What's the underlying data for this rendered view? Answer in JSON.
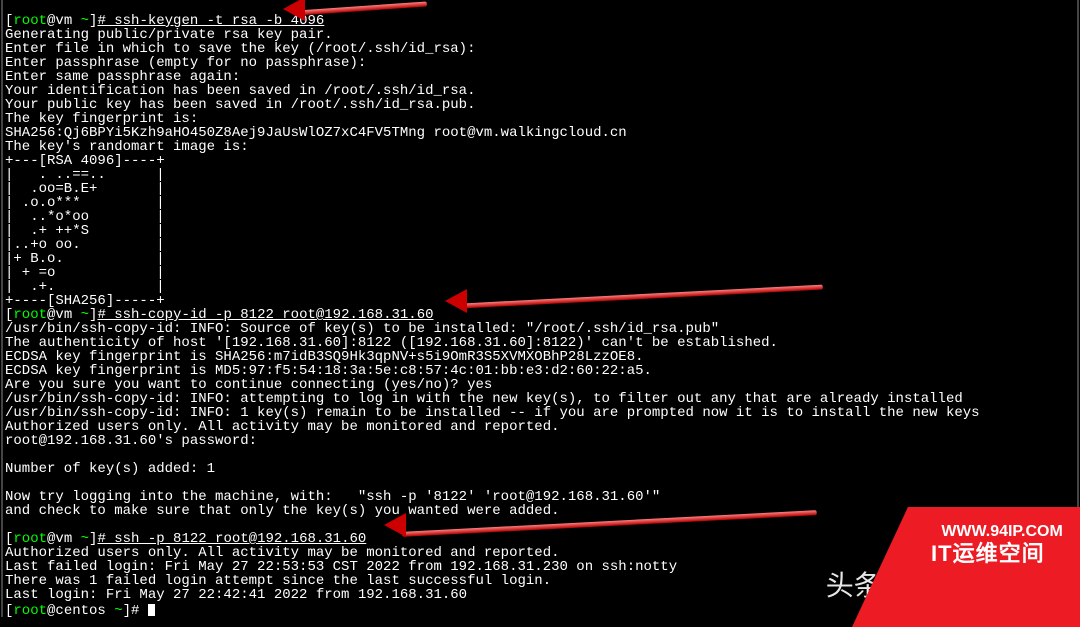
{
  "prompt1_user": "root",
  "prompt1_host": "@vm ",
  "prompt1_dir": "~",
  "prompt1_cmd": "# ssh-keygen -t rsa -b 4096",
  "l2": "Generating public/private rsa key pair.",
  "l3": "Enter file in which to save the key (/root/.ssh/id_rsa):",
  "l4": "Enter passphrase (empty for no passphrase):",
  "l5": "Enter same passphrase again:",
  "l6": "Your identification has been saved in /root/.ssh/id_rsa.",
  "l7": "Your public key has been saved in /root/.ssh/id_rsa.pub.",
  "l8": "The key fingerprint is:",
  "l9": "SHA256:Qj6BPYi5Kzh9aHO450Z8Aej9JaUsWlOZ7xC4FV5TMng root@vm.walkingcloud.cn",
  "l10": "The key's randomart image is:",
  "l11": "+---[RSA 4096]----+",
  "l12": "|   . ..==..      |",
  "l13": "|  .oo=B.E+       |",
  "l14": "| .o.o***         |",
  "l15": "|  ..*o*oo        |",
  "l16": "|  .+ ++*S        |",
  "l17": "|..+o oo.         |",
  "l18": "|+ B.o.           |",
  "l19": "| + =o            |",
  "l20": "|  .+.            |",
  "l21": "+----[SHA256]-----+",
  "prompt2_cmd": "# ssh-copy-id -p 8122 root@192.168.31.60",
  "l23": "/usr/bin/ssh-copy-id: INFO: Source of key(s) to be installed: \"/root/.ssh/id_rsa.pub\"",
  "l24": "The authenticity of host '[192.168.31.60]:8122 ([192.168.31.60]:8122)' can't be established.",
  "l25": "ECDSA key fingerprint is SHA256:m7idB3SQ9Hk3qpNV+s5i9OmR3S5XVMXOBhP28LzzOE8.",
  "l26": "ECDSA key fingerprint is MD5:97:f5:54:18:3a:5e:c8:57:4c:01:bb:e3:d2:60:22:a5.",
  "l27": "Are you sure you want to continue connecting (yes/no)? yes",
  "l28": "/usr/bin/ssh-copy-id: INFO: attempting to log in with the new key(s), to filter out any that are already installed",
  "l29": "/usr/bin/ssh-copy-id: INFO: 1 key(s) remain to be installed -- if you are prompted now it is to install the new keys",
  "l30": "Authorized users only. All activity may be monitored and reported.",
  "l31": "root@192.168.31.60's password:",
  "l32": "",
  "l33": "Number of key(s) added: 1",
  "l34": "",
  "l35": "Now try logging into the machine, with:   \"ssh -p '8122' 'root@192.168.31.60'\"",
  "l36": "and check to make sure that only the key(s) you wanted were added.",
  "l37": "",
  "prompt3_cmd": "# ssh -p 8122 root@192.168.31.60",
  "l39": "Authorized users only. All activity may be monitored and reported.",
  "l40": "Last failed login: Fri May 27 22:53:53 CST 2022 from 192.168.31.230 on ssh:notty",
  "l41": "There was 1 failed login attempt since the last successful login.",
  "l42": "Last login: Fri May 27 22:42:41 2022 from 192.168.31.60",
  "prompt4_host": "@centos ",
  "prompt4_hash": "# ",
  "watermark": "头条 @wal",
  "badge_line1": "WWW.94IP.COM",
  "badge_line2": "IT运维空间"
}
